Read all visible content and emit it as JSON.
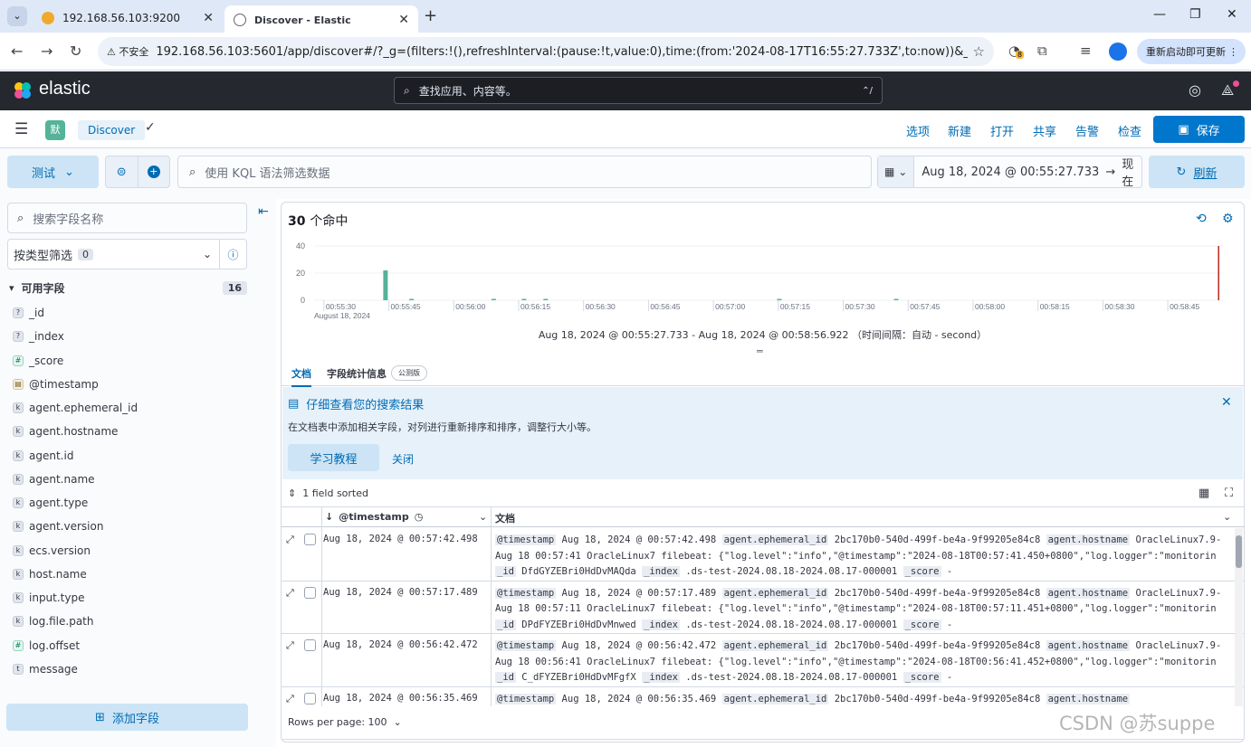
{
  "browser": {
    "tabs": [
      {
        "title": "192.168.56.103:9200",
        "favicon_color": "#f0a92b"
      },
      {
        "title": "Discover - Elastic",
        "favicon_color": "#666666"
      }
    ],
    "security_label": "不安全",
    "url": "192.168.56.103:5601/app/discover#/?_g=(filters:!(),refreshInterval:(pause:!t,value:0),time:(from:'2024-08-17T16:55:27.733Z',to:now))&_a=(column...",
    "extension_badge": "8",
    "relaunch_label": "重新启动即可更新"
  },
  "kibana": {
    "logo_text": "elastic",
    "search_placeholder": "查找应用、内容等。",
    "search_shortcut": "⌃/"
  },
  "appbar": {
    "space_initial": "默",
    "breadcrumb": "Discover",
    "links": [
      "选项",
      "新建",
      "打开",
      "共享",
      "告警",
      "检查"
    ],
    "save_label": "保存"
  },
  "query": {
    "dataview_label": "测试",
    "kql_placeholder": "使用 KQL 语法筛选数据",
    "date_start": "Aug 18, 2024 @ 00:55:27.733",
    "date_end": "现在",
    "refresh_label": "刷新"
  },
  "sidebar": {
    "search_placeholder": "搜索字段名称",
    "filter_type_label": "按类型筛选",
    "filter_type_count": "0",
    "available_label": "可用字段",
    "available_count": "16",
    "fields": [
      {
        "name": "_id",
        "type": "?"
      },
      {
        "name": "_index",
        "type": "?"
      },
      {
        "name": "_score",
        "type": "#"
      },
      {
        "name": "@timestamp",
        "type": "date"
      },
      {
        "name": "agent.ephemeral_id",
        "type": "k"
      },
      {
        "name": "agent.hostname",
        "type": "k"
      },
      {
        "name": "agent.id",
        "type": "k"
      },
      {
        "name": "agent.name",
        "type": "k"
      },
      {
        "name": "agent.type",
        "type": "k"
      },
      {
        "name": "agent.version",
        "type": "k"
      },
      {
        "name": "ecs.version",
        "type": "k"
      },
      {
        "name": "host.name",
        "type": "k"
      },
      {
        "name": "input.type",
        "type": "k"
      },
      {
        "name": "log.file.path",
        "type": "k"
      },
      {
        "name": "log.offset",
        "type": "#"
      },
      {
        "name": "message",
        "type": "t"
      }
    ],
    "add_field_label": "添加字段"
  },
  "main": {
    "hits_count": "30",
    "hits_label": "个命中",
    "range_text": "Aug 18, 2024 @ 00:55:27.733 - Aug 18, 2024 @ 00:58:56.922 （时间间隔：自动 - second）",
    "tab_docs": "文档",
    "tab_fields": "字段统计信息",
    "tech_badge": "公测版",
    "callout_title": "仔细查看您的搜索结果",
    "callout_text": "在文档表中添加相关字段，对列进行重新排序和排序，调整行大小等。",
    "tutorial_label": "学习教程",
    "dismiss_label": "关闭",
    "sorted_label": "1 field sorted",
    "col_timestamp": "@timestamp",
    "col_doc": "文档",
    "rows_per_page": "Rows per page: 100",
    "rows": [
      {
        "ts": "Aug 18, 2024 @ 00:57:42.498",
        "eph": "2bc170b0-540d-499f-be4a-9f99205e84c8",
        "host": "OracleLinux7.9-",
        "msg": "Aug 18 00:57:41 OracleLinux7 filebeat: {\"log.level\":\"info\",\"@timestamp\":\"2024-08-18T00:57:41.450+0800\",\"log.logger\":\"monitorin",
        "id": "DfdGYZEBri0HdDvMAQda",
        "index": ".ds-test-2024.08.18-2024.08.17-000001",
        "score": "-"
      },
      {
        "ts": "Aug 18, 2024 @ 00:57:17.489",
        "eph": "2bc170b0-540d-499f-be4a-9f99205e84c8",
        "host": "OracleLinux7.9-",
        "msg": "Aug 18 00:57:11 OracleLinux7 filebeat: {\"log.level\":\"info\",\"@timestamp\":\"2024-08-18T00:57:11.451+0800\",\"log.logger\":\"monitorin",
        "id": "DPdFYZEBri0HdDvMnwed",
        "index": ".ds-test-2024.08.18-2024.08.17-000001",
        "score": "-"
      },
      {
        "ts": "Aug 18, 2024 @ 00:56:42.472",
        "eph": "2bc170b0-540d-499f-be4a-9f99205e84c8",
        "host": "OracleLinux7.9-",
        "msg": "Aug 18 00:56:41 OracleLinux7 filebeat: {\"log.level\":\"info\",\"@timestamp\":\"2024-08-18T00:56:41.452+0800\",\"log.logger\":\"monitorin",
        "id": "C_dFYZEBri0HdDvMFgfX",
        "index": ".ds-test-2024.08.18-2024.08.17-000001",
        "score": "-"
      },
      {
        "ts": "Aug 18, 2024 @ 00:56:35.469",
        "eph": "2bc170b0-540d-499f-be4a-9f99205e84c8",
        "host": "",
        "msg": "",
        "id": "",
        "index": "",
        "score": ""
      }
    ],
    "field_labels": {
      "ts": "@timestamp",
      "eph": "agent.ephemeral_id",
      "host": "agent.hostname",
      "id": "_id",
      "index": "_index",
      "score": "_score"
    }
  },
  "chart_data": {
    "type": "bar",
    "ylim": [
      0,
      40
    ],
    "yticks": [
      "40",
      "20",
      "0"
    ],
    "xticks": [
      "00:55:30",
      "00:55:45",
      "00:56:00",
      "00:56:15",
      "00:56:30",
      "00:56:45",
      "00:57:00",
      "00:57:15",
      "00:57:30",
      "00:57:45",
      "00:58:00",
      "00:58:15",
      "00:58:30",
      "00:58:45"
    ],
    "xtick_sub": "August 18, 2024",
    "bar_color": "#54b399",
    "now_marker_color": "#bd271e",
    "x_start_sec": 0,
    "x_end_sec": 210,
    "points": [
      {
        "t": 16.5,
        "v": 22
      },
      {
        "t": 22.5,
        "v": 1
      },
      {
        "t": 41.5,
        "v": 1
      },
      {
        "t": 48.5,
        "v": 1
      },
      {
        "t": 53.5,
        "v": 1
      },
      {
        "t": 107.5,
        "v": 1
      },
      {
        "t": 134.5,
        "v": 1
      }
    ],
    "now_t": 209
  },
  "watermark": "CSDN @苏suppe"
}
